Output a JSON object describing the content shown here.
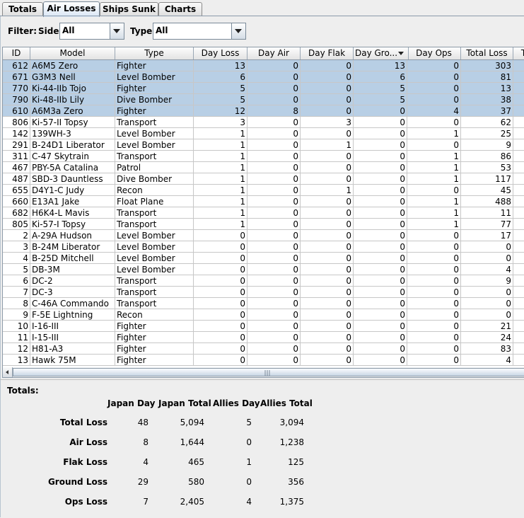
{
  "tabs": [
    {
      "label": "Totals",
      "active": false
    },
    {
      "label": "Air Losses",
      "active": true
    },
    {
      "label": "Ships Sunk",
      "active": false
    },
    {
      "label": "Charts",
      "active": false
    }
  ],
  "filter": {
    "label": "Filter:",
    "side_label": "Side:",
    "side_value": "All",
    "type_label": "Type:",
    "type_value": "All"
  },
  "columns": [
    "ID",
    "Model",
    "Type",
    "Day Loss",
    "Day Air",
    "Day Flak",
    "Day Gro...",
    "Day Ops",
    "Total Loss",
    "T"
  ],
  "sorted_column": "Day Gro...",
  "rows": [
    {
      "id": "612",
      "model": "A6M5 Zero",
      "type": "Fighter",
      "day_loss": "13",
      "day_air": "0",
      "day_flak": "0",
      "day_gro": "13",
      "day_ops": "0",
      "total": "303",
      "sel": true
    },
    {
      "id": "671",
      "model": "G3M3 Nell",
      "type": "Level Bomber",
      "day_loss": "6",
      "day_air": "0",
      "day_flak": "0",
      "day_gro": "6",
      "day_ops": "0",
      "total": "81",
      "sel": true
    },
    {
      "id": "770",
      "model": "Ki-44-IIb Tojo",
      "type": "Fighter",
      "day_loss": "5",
      "day_air": "0",
      "day_flak": "0",
      "day_gro": "5",
      "day_ops": "0",
      "total": "13",
      "sel": true
    },
    {
      "id": "790",
      "model": "Ki-48-IIb Lily",
      "type": "Dive Bomber",
      "day_loss": "5",
      "day_air": "0",
      "day_flak": "0",
      "day_gro": "5",
      "day_ops": "0",
      "total": "38",
      "sel": true
    },
    {
      "id": "610",
      "model": "A6M3a Zero",
      "type": "Fighter",
      "day_loss": "12",
      "day_air": "8",
      "day_flak": "0",
      "day_gro": "0",
      "day_ops": "4",
      "total": "37",
      "sel": true
    },
    {
      "id": "806",
      "model": "Ki-57-II Topsy",
      "type": "Transport",
      "day_loss": "3",
      "day_air": "0",
      "day_flak": "3",
      "day_gro": "0",
      "day_ops": "0",
      "total": "62",
      "sel": false
    },
    {
      "id": "142",
      "model": "139WH-3",
      "type": "Level Bomber",
      "day_loss": "1",
      "day_air": "0",
      "day_flak": "0",
      "day_gro": "0",
      "day_ops": "1",
      "total": "25",
      "sel": false
    },
    {
      "id": "291",
      "model": "B-24D1 Liberator",
      "type": "Level Bomber",
      "day_loss": "1",
      "day_air": "0",
      "day_flak": "1",
      "day_gro": "0",
      "day_ops": "0",
      "total": "9",
      "sel": false
    },
    {
      "id": "311",
      "model": "C-47 Skytrain",
      "type": "Transport",
      "day_loss": "1",
      "day_air": "0",
      "day_flak": "0",
      "day_gro": "0",
      "day_ops": "1",
      "total": "86",
      "sel": false
    },
    {
      "id": "467",
      "model": "PBY-5A Catalina",
      "type": "Patrol",
      "day_loss": "1",
      "day_air": "0",
      "day_flak": "0",
      "day_gro": "0",
      "day_ops": "1",
      "total": "53",
      "sel": false
    },
    {
      "id": "487",
      "model": "SBD-3 Dauntless",
      "type": "Dive Bomber",
      "day_loss": "1",
      "day_air": "0",
      "day_flak": "0",
      "day_gro": "0",
      "day_ops": "1",
      "total": "117",
      "sel": false
    },
    {
      "id": "655",
      "model": "D4Y1-C Judy",
      "type": "Recon",
      "day_loss": "1",
      "day_air": "0",
      "day_flak": "1",
      "day_gro": "0",
      "day_ops": "0",
      "total": "45",
      "sel": false
    },
    {
      "id": "660",
      "model": "E13A1 Jake",
      "type": "Float Plane",
      "day_loss": "1",
      "day_air": "0",
      "day_flak": "0",
      "day_gro": "0",
      "day_ops": "1",
      "total": "488",
      "sel": false
    },
    {
      "id": "682",
      "model": "H6K4-L Mavis",
      "type": "Transport",
      "day_loss": "1",
      "day_air": "0",
      "day_flak": "0",
      "day_gro": "0",
      "day_ops": "1",
      "total": "11",
      "sel": false
    },
    {
      "id": "805",
      "model": "Ki-57-I Topsy",
      "type": "Transport",
      "day_loss": "1",
      "day_air": "0",
      "day_flak": "0",
      "day_gro": "0",
      "day_ops": "1",
      "total": "77",
      "sel": false
    },
    {
      "id": "2",
      "model": "A-29A Hudson",
      "type": "Level Bomber",
      "day_loss": "0",
      "day_air": "0",
      "day_flak": "0",
      "day_gro": "0",
      "day_ops": "0",
      "total": "17",
      "sel": false
    },
    {
      "id": "3",
      "model": "B-24M Liberator",
      "type": "Level Bomber",
      "day_loss": "0",
      "day_air": "0",
      "day_flak": "0",
      "day_gro": "0",
      "day_ops": "0",
      "total": "0",
      "sel": false
    },
    {
      "id": "4",
      "model": "B-25D Mitchell",
      "type": "Level Bomber",
      "day_loss": "0",
      "day_air": "0",
      "day_flak": "0",
      "day_gro": "0",
      "day_ops": "0",
      "total": "0",
      "sel": false
    },
    {
      "id": "5",
      "model": "DB-3M",
      "type": "Level Bomber",
      "day_loss": "0",
      "day_air": "0",
      "day_flak": "0",
      "day_gro": "0",
      "day_ops": "0",
      "total": "4",
      "sel": false
    },
    {
      "id": "6",
      "model": "DC-2",
      "type": "Transport",
      "day_loss": "0",
      "day_air": "0",
      "day_flak": "0",
      "day_gro": "0",
      "day_ops": "0",
      "total": "9",
      "sel": false
    },
    {
      "id": "7",
      "model": "DC-3",
      "type": "Transport",
      "day_loss": "0",
      "day_air": "0",
      "day_flak": "0",
      "day_gro": "0",
      "day_ops": "0",
      "total": "0",
      "sel": false
    },
    {
      "id": "8",
      "model": "C-46A Commando",
      "type": "Transport",
      "day_loss": "0",
      "day_air": "0",
      "day_flak": "0",
      "day_gro": "0",
      "day_ops": "0",
      "total": "0",
      "sel": false
    },
    {
      "id": "9",
      "model": "F-5E Lightning",
      "type": "Recon",
      "day_loss": "0",
      "day_air": "0",
      "day_flak": "0",
      "day_gro": "0",
      "day_ops": "0",
      "total": "0",
      "sel": false
    },
    {
      "id": "10",
      "model": "I-16-III",
      "type": "Fighter",
      "day_loss": "0",
      "day_air": "0",
      "day_flak": "0",
      "day_gro": "0",
      "day_ops": "0",
      "total": "21",
      "sel": false
    },
    {
      "id": "11",
      "model": "I-15-III",
      "type": "Fighter",
      "day_loss": "0",
      "day_air": "0",
      "day_flak": "0",
      "day_gro": "0",
      "day_ops": "0",
      "total": "24",
      "sel": false
    },
    {
      "id": "12",
      "model": "H81-A3",
      "type": "Fighter",
      "day_loss": "0",
      "day_air": "0",
      "day_flak": "0",
      "day_gro": "0",
      "day_ops": "0",
      "total": "83",
      "sel": false
    },
    {
      "id": "13",
      "model": "Hawk 75M",
      "type": "Fighter",
      "day_loss": "0",
      "day_air": "0",
      "day_flak": "0",
      "day_gro": "0",
      "day_ops": "0",
      "total": "4",
      "sel": false
    }
  ],
  "totals": {
    "title": "Totals:",
    "headers": [
      "Japan Day",
      "Japan Total",
      "Allies Day",
      "Allies Total"
    ],
    "rows": [
      {
        "label": "Total Loss",
        "values": [
          "48",
          "5,094",
          "5",
          "3,094"
        ]
      },
      {
        "label": "Air Loss",
        "values": [
          "8",
          "1,644",
          "0",
          "1,238"
        ]
      },
      {
        "label": "Flak Loss",
        "values": [
          "4",
          "465",
          "1",
          "125"
        ]
      },
      {
        "label": "Ground Loss",
        "values": [
          "29",
          "580",
          "0",
          "356"
        ]
      },
      {
        "label": "Ops Loss",
        "values": [
          "7",
          "2,405",
          "4",
          "1,375"
        ]
      }
    ]
  },
  "colors": {
    "selection": "#b8cfe5",
    "grid_line": "#c7c7c7",
    "header": "#e3e3e3"
  }
}
